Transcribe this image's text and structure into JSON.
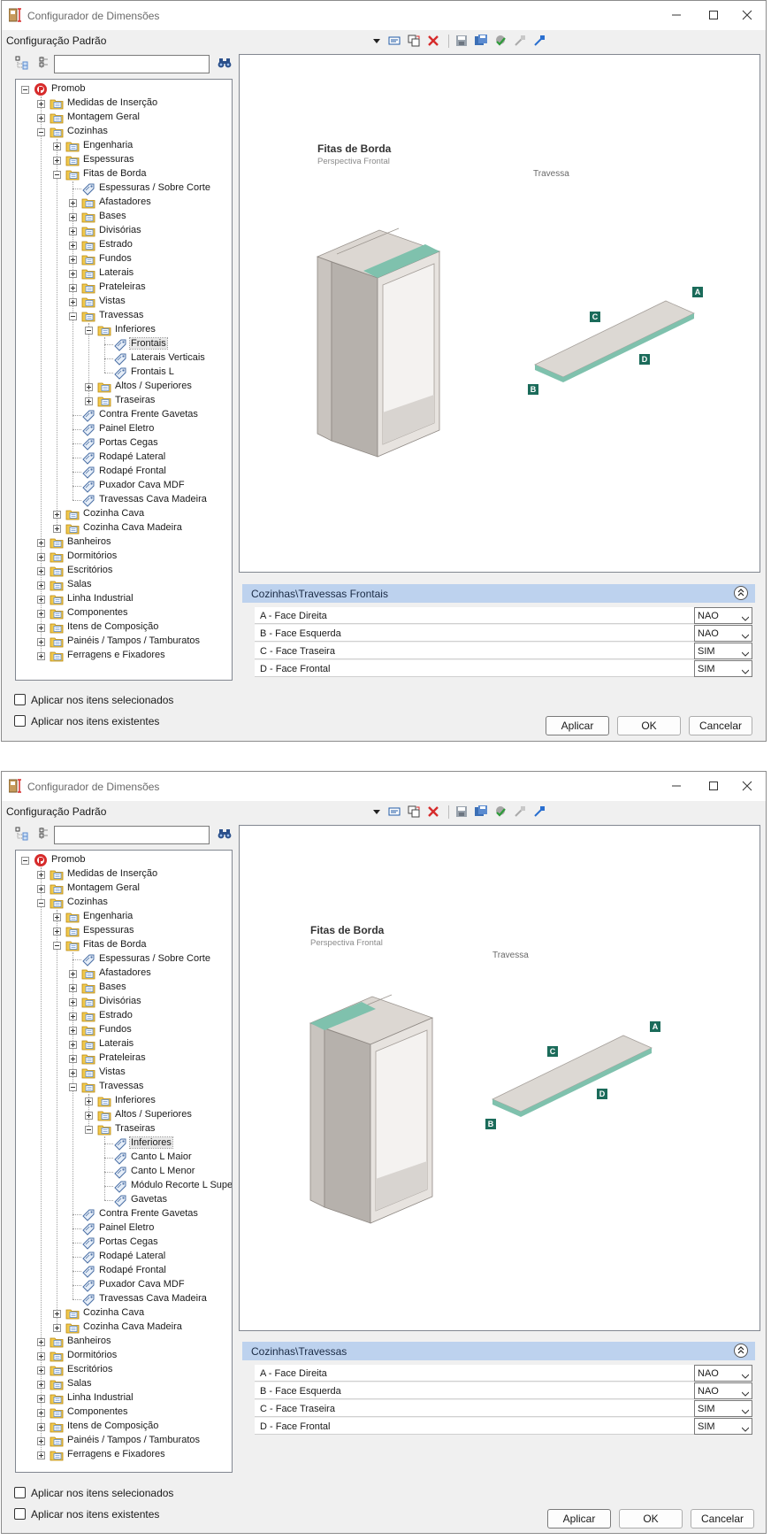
{
  "windows": [
    {
      "title": "Configurador de Dimensões",
      "config_label": "Configuração Padrão",
      "search_value": "",
      "tree": [
        {
          "label": "Promob",
          "icon": "promob",
          "exp": "minus",
          "indent": 0
        },
        {
          "label": "Medidas de Inserção",
          "icon": "folder",
          "exp": "plus",
          "indent": 1
        },
        {
          "label": "Montagem Geral",
          "icon": "folder",
          "exp": "plus",
          "indent": 1
        },
        {
          "label": "Cozinhas",
          "icon": "folder",
          "exp": "minus",
          "indent": 1
        },
        {
          "label": "Engenharia",
          "icon": "folder",
          "exp": "plus",
          "indent": 2
        },
        {
          "label": "Espessuras",
          "icon": "folder",
          "exp": "plus",
          "indent": 2
        },
        {
          "label": "Fitas de Borda",
          "icon": "folder",
          "exp": "minus",
          "indent": 2
        },
        {
          "label": "Espessuras / Sobre Corte",
          "icon": "tag",
          "exp": "none",
          "indent": 3
        },
        {
          "label": "Afastadores",
          "icon": "folder",
          "exp": "plus",
          "indent": 3
        },
        {
          "label": "Bases",
          "icon": "folder",
          "exp": "plus",
          "indent": 3
        },
        {
          "label": "Divisórias",
          "icon": "folder",
          "exp": "plus",
          "indent": 3
        },
        {
          "label": "Estrado",
          "icon": "folder",
          "exp": "plus",
          "indent": 3
        },
        {
          "label": "Fundos",
          "icon": "folder",
          "exp": "plus",
          "indent": 3
        },
        {
          "label": "Laterais",
          "icon": "folder",
          "exp": "plus",
          "indent": 3
        },
        {
          "label": "Prateleiras",
          "icon": "folder",
          "exp": "plus",
          "indent": 3
        },
        {
          "label": "Vistas",
          "icon": "folder",
          "exp": "plus",
          "indent": 3
        },
        {
          "label": "Travessas",
          "icon": "folder",
          "exp": "minus",
          "indent": 3
        },
        {
          "label": "Inferiores",
          "icon": "folder",
          "exp": "minus",
          "indent": 4
        },
        {
          "label": "Frontais",
          "icon": "tag",
          "exp": "none",
          "indent": 5,
          "selected": true
        },
        {
          "label": "Laterais Verticais",
          "icon": "tag",
          "exp": "none",
          "indent": 5
        },
        {
          "label": "Frontais L",
          "icon": "tag",
          "exp": "none",
          "indent": 5
        },
        {
          "label": "Altos / Superiores",
          "icon": "folder",
          "exp": "plus",
          "indent": 4
        },
        {
          "label": "Traseiras",
          "icon": "folder",
          "exp": "plus",
          "indent": 4
        },
        {
          "label": "Contra Frente Gavetas",
          "icon": "tag",
          "exp": "none",
          "indent": 3
        },
        {
          "label": "Painel Eletro",
          "icon": "tag",
          "exp": "none",
          "indent": 3
        },
        {
          "label": "Portas Cegas",
          "icon": "tag",
          "exp": "none",
          "indent": 3
        },
        {
          "label": "Rodapé Lateral",
          "icon": "tag",
          "exp": "none",
          "indent": 3
        },
        {
          "label": "Rodapé Frontal",
          "icon": "tag",
          "exp": "none",
          "indent": 3
        },
        {
          "label": "Puxador Cava MDF",
          "icon": "tag",
          "exp": "none",
          "indent": 3
        },
        {
          "label": "Travessas Cava Madeira",
          "icon": "tag",
          "exp": "none",
          "indent": 3
        },
        {
          "label": "Cozinha Cava",
          "icon": "folder",
          "exp": "plus",
          "indent": 2
        },
        {
          "label": "Cozinha Cava Madeira",
          "icon": "folder",
          "exp": "plus",
          "indent": 2
        },
        {
          "label": "Banheiros",
          "icon": "folder",
          "exp": "plus",
          "indent": 1
        },
        {
          "label": "Dormitórios",
          "icon": "folder",
          "exp": "plus",
          "indent": 1
        },
        {
          "label": "Escritórios",
          "icon": "folder",
          "exp": "plus",
          "indent": 1
        },
        {
          "label": "Salas",
          "icon": "folder",
          "exp": "plus",
          "indent": 1
        },
        {
          "label": "Linha Industrial",
          "icon": "folder",
          "exp": "plus",
          "indent": 1
        },
        {
          "label": "Componentes",
          "icon": "folder",
          "exp": "plus",
          "indent": 1
        },
        {
          "label": "Itens de Composição",
          "icon": "folder",
          "exp": "plus",
          "indent": 1
        },
        {
          "label": "Painéis / Tampos / Tamburatos",
          "icon": "folder",
          "exp": "plus",
          "indent": 1
        },
        {
          "label": "Ferragens e Fixadores",
          "icon": "folder",
          "exp": "plus",
          "indent": 1
        }
      ],
      "preview": {
        "title": "Fitas de Borda",
        "subtitle": "Perspectiva Frontal",
        "part": "Travessa",
        "edge_labels": [
          "A",
          "B",
          "C",
          "D"
        ],
        "highlight": "front"
      },
      "props_path": "Cozinhas\\Travessas Frontais",
      "props": [
        {
          "label": "A - Face Direita",
          "value": "NAO"
        },
        {
          "label": "B - Face Esquerda",
          "value": "NAO"
        },
        {
          "label": "C - Face Traseira",
          "value": "SIM"
        },
        {
          "label": "D - Face Frontal",
          "value": "SIM"
        }
      ],
      "check_selected": "Aplicar nos itens selecionados",
      "check_existing": "Aplicar nos itens existentes",
      "buttons": {
        "apply": "Aplicar",
        "ok": "OK",
        "cancel": "Cancelar"
      }
    },
    {
      "title": "Configurador de Dimensões",
      "config_label": "Configuração Padrão",
      "search_value": "",
      "tree": [
        {
          "label": "Promob",
          "icon": "promob",
          "exp": "minus",
          "indent": 0
        },
        {
          "label": "Medidas de Inserção",
          "icon": "folder",
          "exp": "plus",
          "indent": 1
        },
        {
          "label": "Montagem Geral",
          "icon": "folder",
          "exp": "plus",
          "indent": 1
        },
        {
          "label": "Cozinhas",
          "icon": "folder",
          "exp": "minus",
          "indent": 1
        },
        {
          "label": "Engenharia",
          "icon": "folder",
          "exp": "plus",
          "indent": 2
        },
        {
          "label": "Espessuras",
          "icon": "folder",
          "exp": "plus",
          "indent": 2
        },
        {
          "label": "Fitas de Borda",
          "icon": "folder",
          "exp": "minus",
          "indent": 2
        },
        {
          "label": "Espessuras / Sobre Corte",
          "icon": "tag",
          "exp": "none",
          "indent": 3
        },
        {
          "label": "Afastadores",
          "icon": "folder",
          "exp": "plus",
          "indent": 3
        },
        {
          "label": "Bases",
          "icon": "folder",
          "exp": "plus",
          "indent": 3
        },
        {
          "label": "Divisórias",
          "icon": "folder",
          "exp": "plus",
          "indent": 3
        },
        {
          "label": "Estrado",
          "icon": "folder",
          "exp": "plus",
          "indent": 3
        },
        {
          "label": "Fundos",
          "icon": "folder",
          "exp": "plus",
          "indent": 3
        },
        {
          "label": "Laterais",
          "icon": "folder",
          "exp": "plus",
          "indent": 3
        },
        {
          "label": "Prateleiras",
          "icon": "folder",
          "exp": "plus",
          "indent": 3
        },
        {
          "label": "Vistas",
          "icon": "folder",
          "exp": "plus",
          "indent": 3
        },
        {
          "label": "Travessas",
          "icon": "folder",
          "exp": "minus",
          "indent": 3
        },
        {
          "label": "Inferiores",
          "icon": "folder",
          "exp": "plus",
          "indent": 4
        },
        {
          "label": "Altos / Superiores",
          "icon": "folder",
          "exp": "plus",
          "indent": 4
        },
        {
          "label": "Traseiras",
          "icon": "folder",
          "exp": "minus",
          "indent": 4
        },
        {
          "label": "Inferiores",
          "icon": "tag",
          "exp": "none",
          "indent": 5,
          "selected": true
        },
        {
          "label": "Canto L Maior",
          "icon": "tag",
          "exp": "none",
          "indent": 5
        },
        {
          "label": "Canto L Menor",
          "icon": "tag",
          "exp": "none",
          "indent": 5
        },
        {
          "label": "Módulo Recorte L Superior",
          "icon": "tag",
          "exp": "none",
          "indent": 5
        },
        {
          "label": "Gavetas",
          "icon": "tag",
          "exp": "none",
          "indent": 5
        },
        {
          "label": "Contra Frente Gavetas",
          "icon": "tag",
          "exp": "none",
          "indent": 3
        },
        {
          "label": "Painel Eletro",
          "icon": "tag",
          "exp": "none",
          "indent": 3
        },
        {
          "label": "Portas Cegas",
          "icon": "tag",
          "exp": "none",
          "indent": 3
        },
        {
          "label": "Rodapé Lateral",
          "icon": "tag",
          "exp": "none",
          "indent": 3
        },
        {
          "label": "Rodapé Frontal",
          "icon": "tag",
          "exp": "none",
          "indent": 3
        },
        {
          "label": "Puxador Cava MDF",
          "icon": "tag",
          "exp": "none",
          "indent": 3
        },
        {
          "label": "Travessas Cava Madeira",
          "icon": "tag",
          "exp": "none",
          "indent": 3
        },
        {
          "label": "Cozinha Cava",
          "icon": "folder",
          "exp": "plus",
          "indent": 2
        },
        {
          "label": "Cozinha Cava Madeira",
          "icon": "folder",
          "exp": "plus",
          "indent": 2
        },
        {
          "label": "Banheiros",
          "icon": "folder",
          "exp": "plus",
          "indent": 1
        },
        {
          "label": "Dormitórios",
          "icon": "folder",
          "exp": "plus",
          "indent": 1
        },
        {
          "label": "Escritórios",
          "icon": "folder",
          "exp": "plus",
          "indent": 1
        },
        {
          "label": "Salas",
          "icon": "folder",
          "exp": "plus",
          "indent": 1
        },
        {
          "label": "Linha Industrial",
          "icon": "folder",
          "exp": "plus",
          "indent": 1
        },
        {
          "label": "Componentes",
          "icon": "folder",
          "exp": "plus",
          "indent": 1
        },
        {
          "label": "Itens de Composição",
          "icon": "folder",
          "exp": "plus",
          "indent": 1
        },
        {
          "label": "Painéis / Tampos / Tamburatos",
          "icon": "folder",
          "exp": "plus",
          "indent": 1
        },
        {
          "label": "Ferragens e Fixadores",
          "icon": "folder",
          "exp": "plus",
          "indent": 1
        }
      ],
      "preview": {
        "title": "Fitas de Borda",
        "subtitle": "Perspectiva Frontal",
        "part": "Travessa",
        "edge_labels": [
          "A",
          "B",
          "C",
          "D"
        ],
        "highlight": "back"
      },
      "props_path": "Cozinhas\\Travessas",
      "props": [
        {
          "label": "A - Face Direita",
          "value": "NAO"
        },
        {
          "label": "B - Face Esquerda",
          "value": "NAO"
        },
        {
          "label": "C - Face Traseira",
          "value": "SIM"
        },
        {
          "label": "D - Face Frontal",
          "value": "SIM"
        }
      ],
      "check_selected": "Aplicar nos itens selecionados",
      "check_existing": "Aplicar nos itens existentes",
      "buttons": {
        "apply": "Aplicar",
        "ok": "OK",
        "cancel": "Cancelar"
      }
    }
  ],
  "colors": {
    "edge_band": "#7fc1ad",
    "label_badge": "#1b6b5a",
    "props_header": "#bdd2ee"
  },
  "toolbar_icons": [
    "new-config-icon",
    "copy-config-icon",
    "delete-icon",
    "save-icon",
    "save-all-icon",
    "validate-icon",
    "export-icon",
    "import-icon"
  ]
}
